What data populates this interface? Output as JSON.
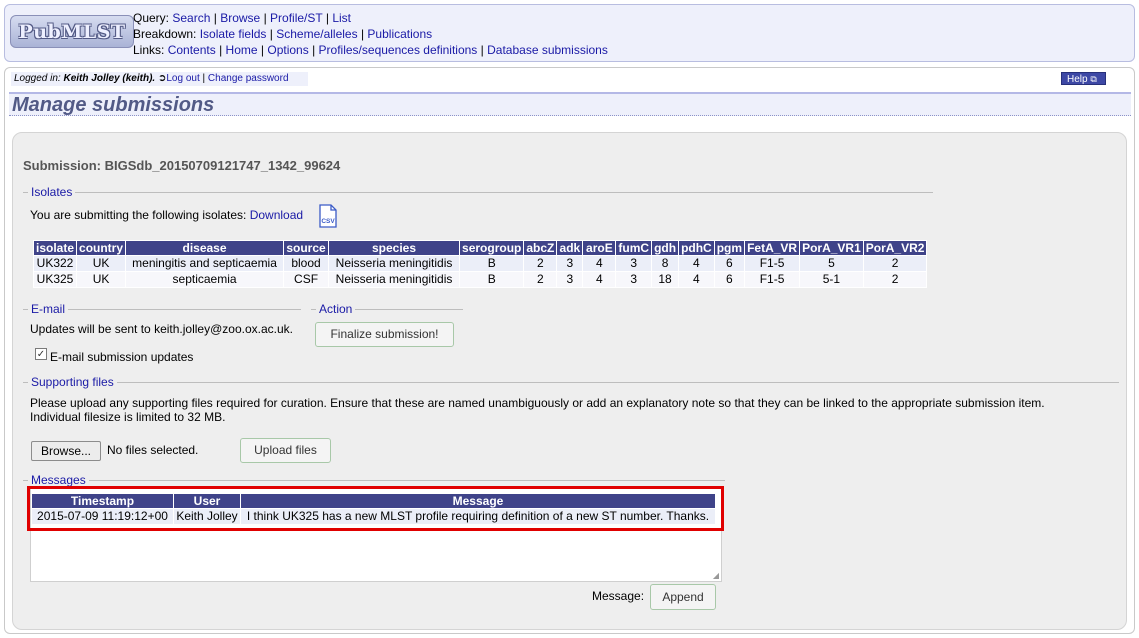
{
  "logo": {
    "text": "PubMLST"
  },
  "header": {
    "query_label": "Query:",
    "query_links": [
      "Search",
      "Browse",
      "Profile/ST",
      "List"
    ],
    "breakdown_label": "Breakdown:",
    "breakdown_links": [
      "Isolate fields",
      "Scheme/alleles",
      "Publications"
    ],
    "links_label": "Links:",
    "links_links": [
      "Contents",
      "Home",
      "Options",
      "Profiles/sequences definitions",
      "Database submissions"
    ]
  },
  "session": {
    "logged_in_label": "Logged in:",
    "user": "Keith Jolley (keith).",
    "logout": "Log out",
    "sep": "|",
    "change_password": "Change password",
    "help": "Help"
  },
  "page_title": "Manage submissions",
  "submission": {
    "title": "Submission: BIGSdb_20150709121747_1342_99624"
  },
  "isolates": {
    "legend": "Isolates",
    "intro": "You are submitting the following isolates:",
    "download": "Download",
    "csv_icon_text": "CSV",
    "columns": [
      "isolate",
      "country",
      "disease",
      "source",
      "species",
      "serogroup",
      "abcZ",
      "adk",
      "aroE",
      "fumC",
      "gdh",
      "pdhC",
      "pgm",
      "FetA_VR",
      "PorA_VR1",
      "PorA_VR2"
    ],
    "rows": [
      [
        "UK322",
        "UK",
        "meningitis and septicaemia",
        "blood",
        "Neisseria meningitidis",
        "B",
        "2",
        "3",
        "4",
        "3",
        "8",
        "4",
        "6",
        "F1-5",
        "5",
        "2"
      ],
      [
        "UK325",
        "UK",
        "septicaemia",
        "CSF",
        "Neisseria meningitidis",
        "B",
        "2",
        "3",
        "4",
        "3",
        "18",
        "4",
        "6",
        "F1-5",
        "5-1",
        "2"
      ]
    ]
  },
  "email": {
    "legend": "E-mail",
    "text": "Updates will be sent to keith.jolley@zoo.ox.ac.uk.",
    "checkbox_label": "E-mail submission updates",
    "checked_mark": "✓"
  },
  "action": {
    "legend": "Action",
    "button": "Finalize submission!"
  },
  "files": {
    "legend": "Supporting files",
    "text1": "Please upload any supporting files required for curation. Ensure that these are named unambiguously or add an explanatory note so that they can be linked to the appropriate submission item.",
    "text2": "Individual filesize is limited to 32 MB.",
    "browse": "Browse...",
    "no_files": "No files selected.",
    "upload": "Upload files"
  },
  "messages": {
    "legend": "Messages",
    "columns": [
      "Timestamp",
      "User",
      "Message"
    ],
    "rows": [
      [
        "2015-07-09 11:19:12+00",
        "Keith Jolley",
        "I think UK325 has a new MLST profile requiring definition of a new ST number. Thanks."
      ]
    ],
    "message_label": "Message:",
    "append": "Append"
  },
  "colors": {
    "table_header": "#3f4389",
    "link": "#1a1aa6",
    "highlight": "#e00000"
  }
}
